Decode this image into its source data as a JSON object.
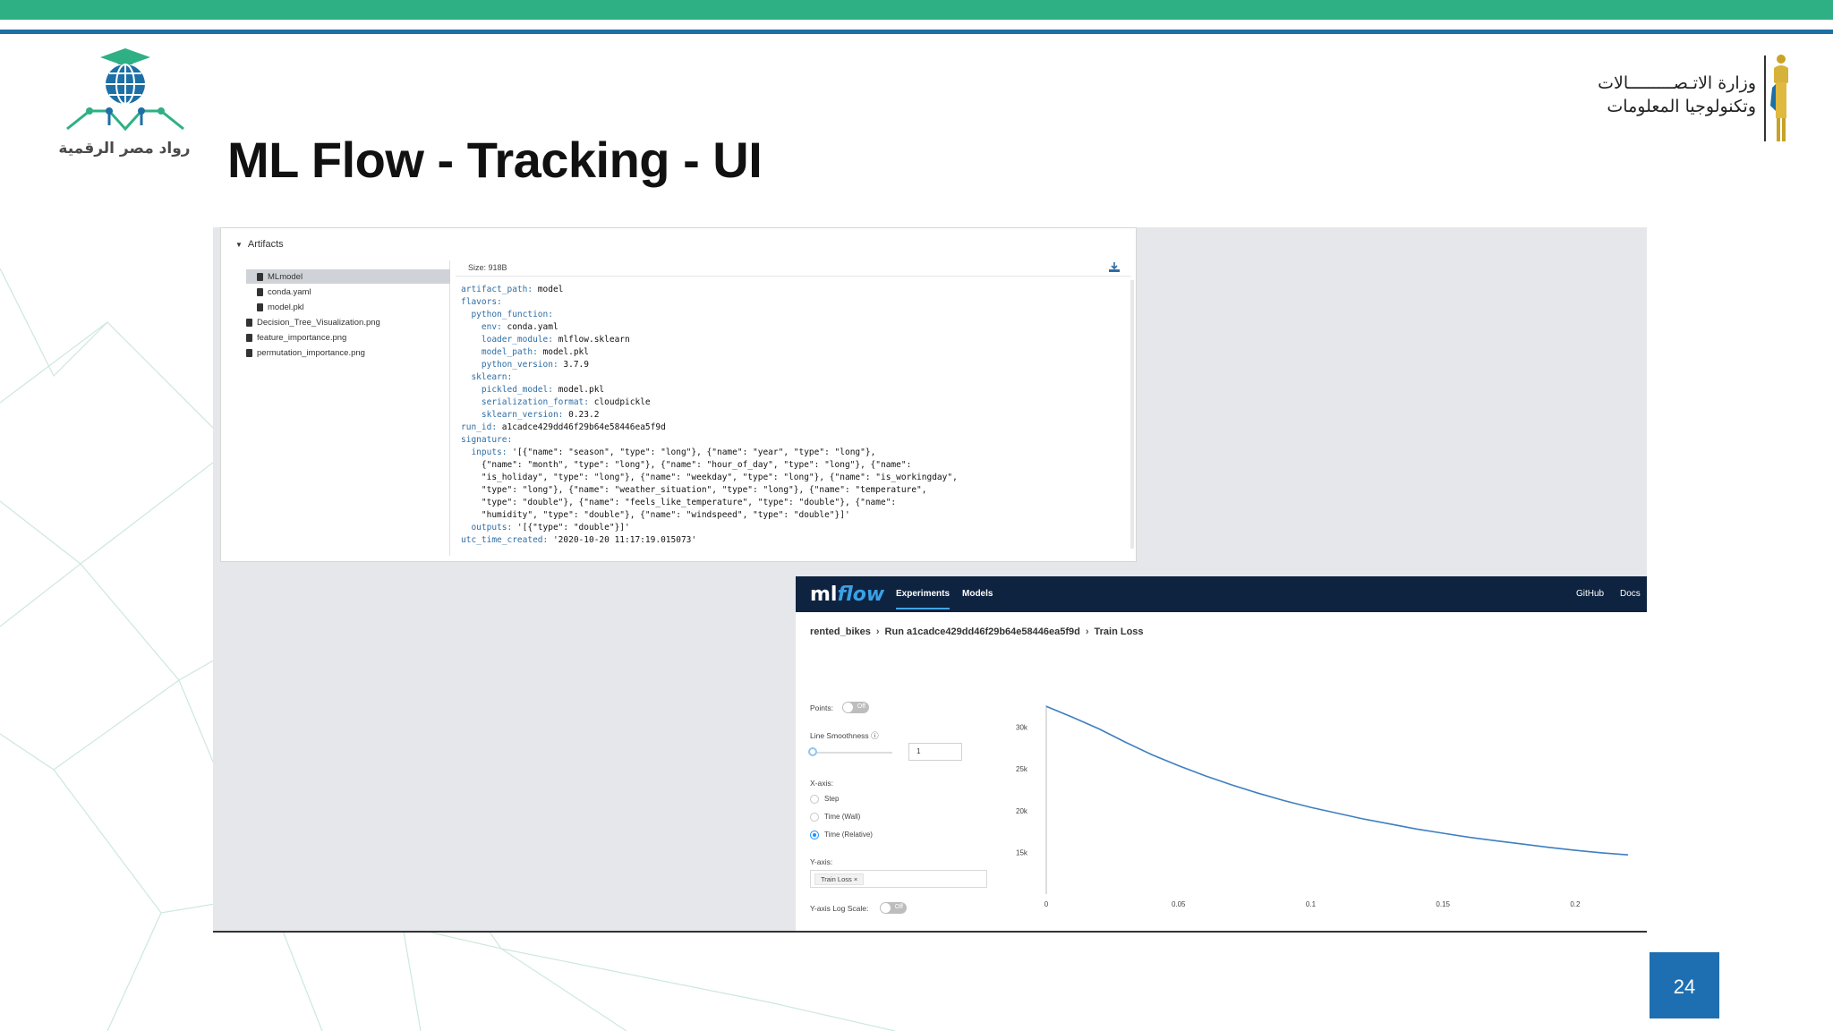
{
  "slide": {
    "title": "ML Flow - Tracking - UI",
    "page_number": "24",
    "left_logo_text": "رواد مصر الرقمية",
    "right_logo_line1": "وزارة الاتـصـــــــــالات",
    "right_logo_line2": "وتكنولوجيا المعلومات",
    "colors": {
      "top_bar": "#2eb084",
      "rule": "#1d6fa5",
      "page_box": "#1e6fb1"
    }
  },
  "artifacts": {
    "header": "Artifacts",
    "items": [
      {
        "label": "MLmodel",
        "selected": true
      },
      {
        "label": "conda.yaml"
      },
      {
        "label": "model.pkl"
      },
      {
        "label": "Decision_Tree_Visualization.png"
      },
      {
        "label": "feature_importance.png"
      },
      {
        "label": "permutation_importance.png"
      }
    ],
    "size_label": "Size: 918B",
    "yaml_lines": [
      {
        "key": "artifact_path:",
        "value": " model"
      },
      {
        "key": "flavors:",
        "value": ""
      },
      {
        "key": "  python_function:",
        "value": ""
      },
      {
        "key": "    env:",
        "value": " conda.yaml"
      },
      {
        "key": "    loader_module:",
        "value": " mlflow.sklearn"
      },
      {
        "key": "    model_path:",
        "value": " model.pkl"
      },
      {
        "key": "    python_version:",
        "value": " 3.7.9"
      },
      {
        "key": "  sklearn:",
        "value": ""
      },
      {
        "key": "    pickled_model:",
        "value": " model.pkl"
      },
      {
        "key": "    serialization_format:",
        "value": " cloudpickle"
      },
      {
        "key": "    sklearn_version:",
        "value": " 0.23.2"
      },
      {
        "key": "run_id:",
        "value": " a1cadce429dd46f29b64e58446ea5f9d"
      },
      {
        "key": "signature:",
        "value": ""
      },
      {
        "key": "  inputs:",
        "value": " '[{\"name\": \"season\", \"type\": \"long\"}, {\"name\": \"year\", \"type\": \"long\"},"
      },
      {
        "key": "",
        "value": "    {\"name\": \"month\", \"type\": \"long\"}, {\"name\": \"hour_of_day\", \"type\": \"long\"}, {\"name\":"
      },
      {
        "key": "",
        "value": "    \"is_holiday\", \"type\": \"long\"}, {\"name\": \"weekday\", \"type\": \"long\"}, {\"name\": \"is_workingday\","
      },
      {
        "key": "",
        "value": "    \"type\": \"long\"}, {\"name\": \"weather_situation\", \"type\": \"long\"}, {\"name\": \"temperature\","
      },
      {
        "key": "",
        "value": "    \"type\": \"double\"}, {\"name\": \"feels_like_temperature\", \"type\": \"double\"}, {\"name\":"
      },
      {
        "key": "",
        "value": "    \"humidity\", \"type\": \"double\"}, {\"name\": \"windspeed\", \"type\": \"double\"}]'"
      },
      {
        "key": "  outputs:",
        "value": " '[{\"type\": \"double\"}]'"
      },
      {
        "key": "utc_time_created:",
        "value": " '2020-10-20 11:17:19.015073'"
      }
    ]
  },
  "mlflow": {
    "logo_ml": "ml",
    "logo_flow": "flow",
    "tabs": [
      "Experiments",
      "Models"
    ],
    "nav_right": [
      "GitHub",
      "Docs"
    ],
    "breadcrumb": [
      "rented_bikes",
      "Run a1cadce429dd46f29b64e58446ea5f9d",
      "Train Loss"
    ],
    "controls": {
      "points_label": "Points:",
      "points_toggle": "Off",
      "smoothness_label": "Line Smoothness",
      "smoothness_value": "1",
      "xaxis_label": "X-axis:",
      "xaxis_options": [
        "Step",
        "Time (Wall)",
        "Time (Relative)"
      ],
      "xaxis_selected": "Time (Relative)",
      "yaxis_label": "Y-axis:",
      "yaxis_chip": "Train Loss ×",
      "log_scale_label": "Y-axis Log Scale:",
      "log_scale_toggle": "Off"
    }
  },
  "chart_data": {
    "type": "line",
    "title": "",
    "xlabel": "",
    "ylabel": "",
    "x_ticks": [
      "0",
      "0.05",
      "0.1",
      "0.15",
      "0.2"
    ],
    "y_ticks": [
      "15k",
      "20k",
      "25k",
      "30k"
    ],
    "xlim": [
      0,
      0.22
    ],
    "ylim": [
      10000,
      32000
    ],
    "grid": false,
    "series": [
      {
        "color": "#3e7fc1",
        "x": [
          0,
          0.01,
          0.02,
          0.03,
          0.04,
          0.05,
          0.06,
          0.07,
          0.08,
          0.09,
          0.1,
          0.11,
          0.12,
          0.13,
          0.14,
          0.15,
          0.16,
          0.17,
          0.18,
          0.19,
          0.2,
          0.21,
          0.22
        ],
        "y": [
          32500,
          31200,
          29800,
          28200,
          26700,
          25400,
          24200,
          23100,
          22100,
          21200,
          20400,
          19700,
          19000,
          18400,
          17800,
          17300,
          16800,
          16400,
          16000,
          15600,
          15250,
          14950,
          14700
        ]
      }
    ]
  }
}
